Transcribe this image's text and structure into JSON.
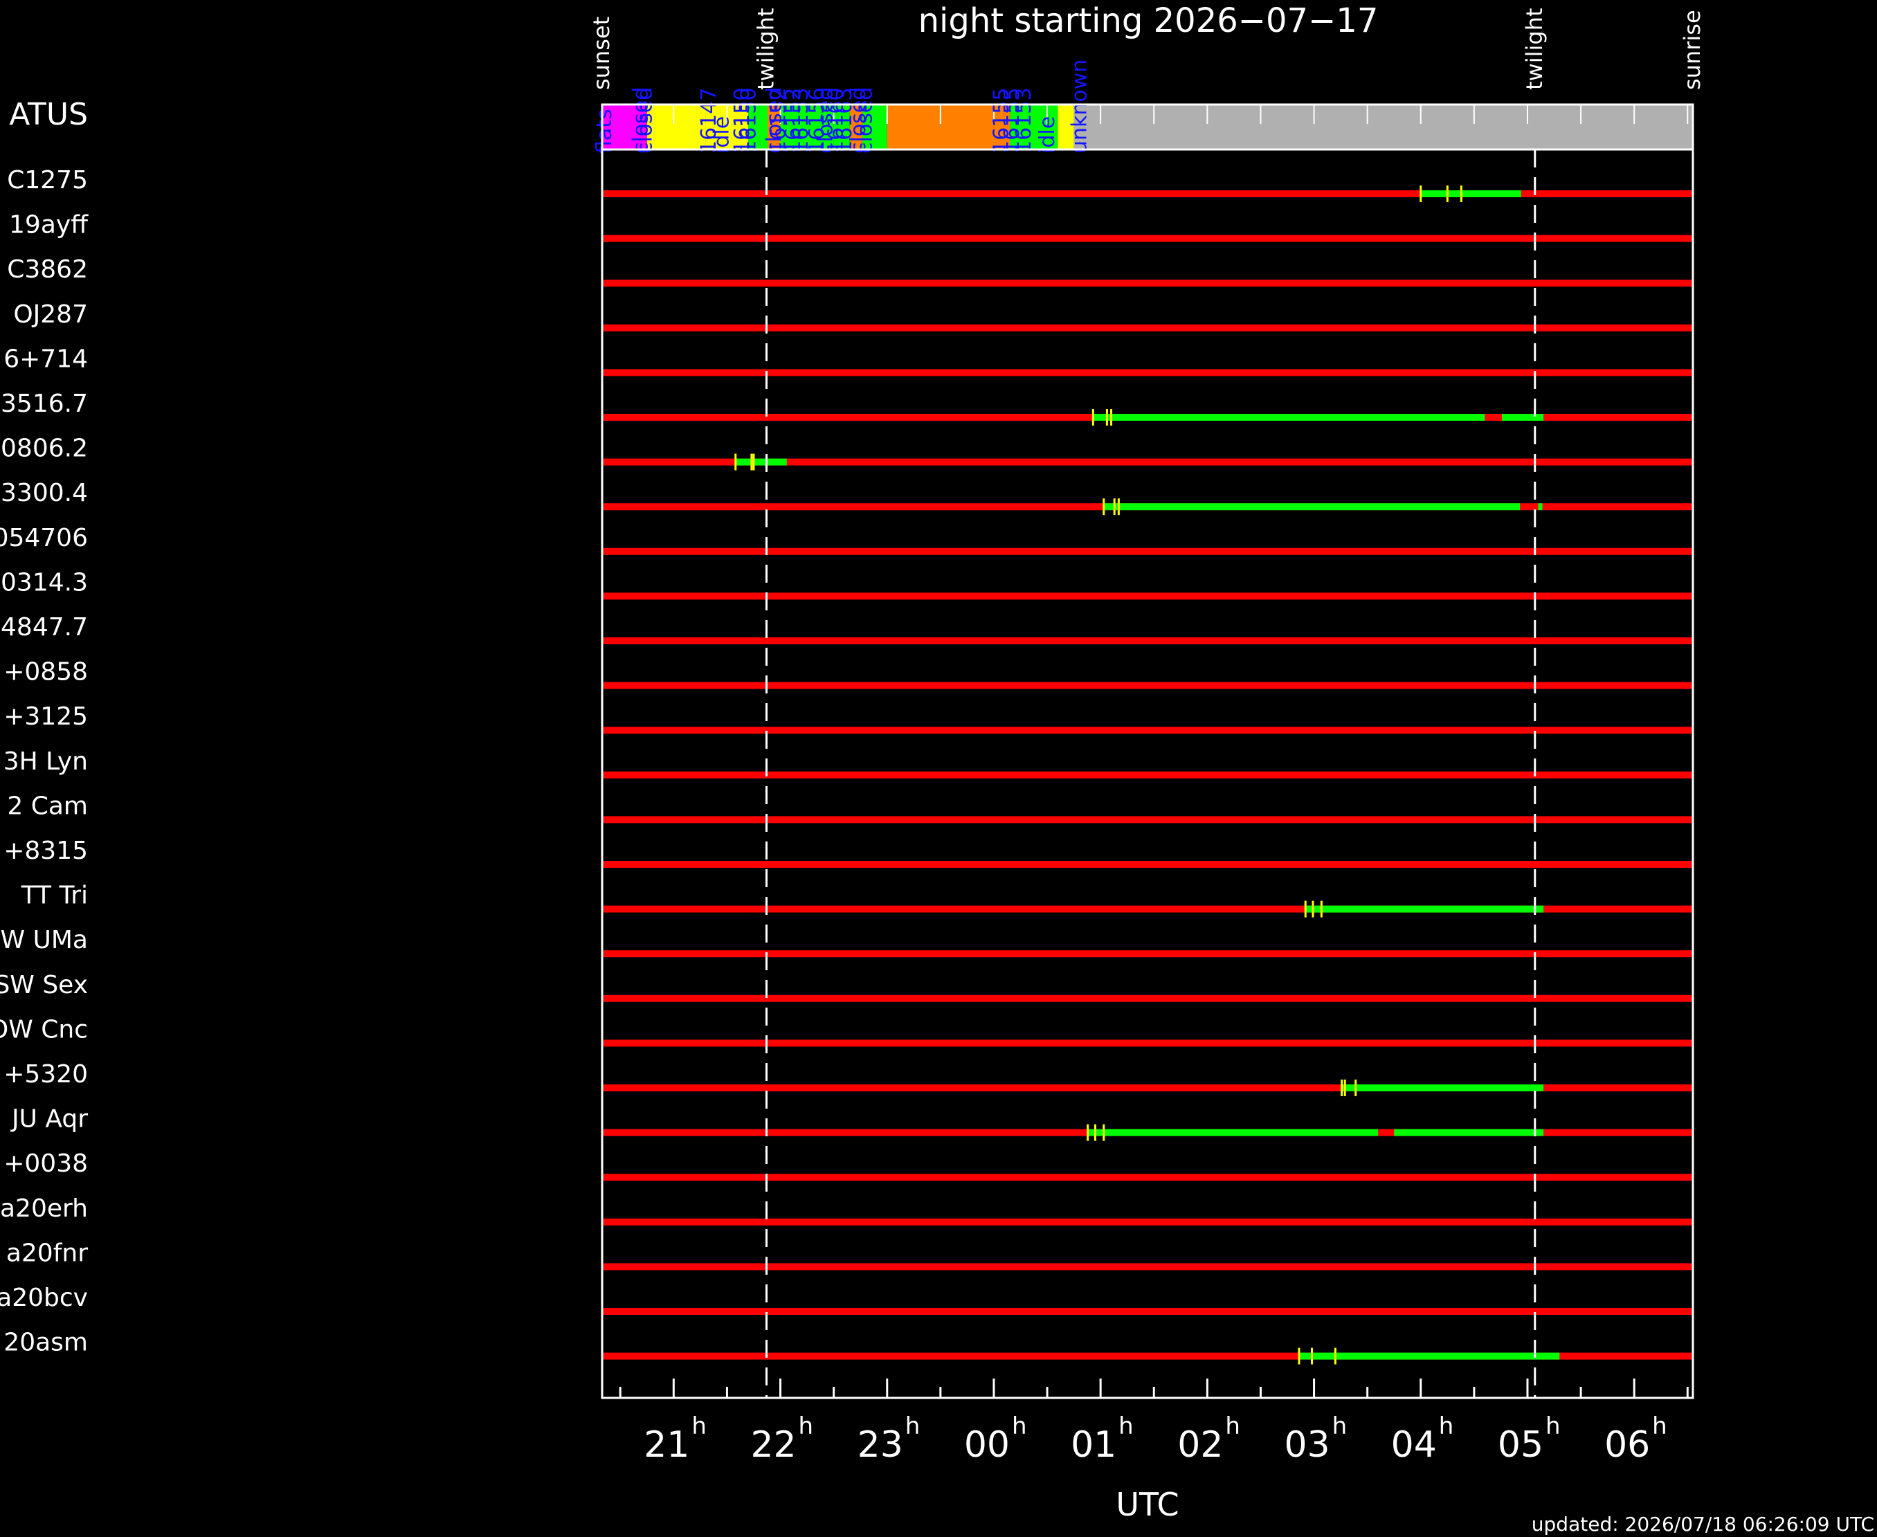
{
  "title": "night starting 2026−07−17",
  "status_label": "ATUS",
  "updated": "updated: 2026/07/18 06:26:09 UTC",
  "colors": {
    "red": "#ff0000",
    "green": "#00ff00",
    "yellow": "#ffff00",
    "magenta": "#ff00ff",
    "orange": "#ff8000",
    "gray": "#b0b0b0",
    "blue": "#1414ff"
  },
  "chart_data": {
    "type": "timeline",
    "xlabel": "UTC",
    "xlim": [
      20.33,
      30.55
    ],
    "x_ticks": [
      {
        "v": 21,
        "label": "21",
        "sup": "h"
      },
      {
        "v": 22,
        "label": "22",
        "sup": "h"
      },
      {
        "v": 23,
        "label": "23",
        "sup": "h"
      },
      {
        "v": 24,
        "label": "00",
        "sup": "h"
      },
      {
        "v": 25,
        "label": "01",
        "sup": "h"
      },
      {
        "v": 26,
        "label": "02",
        "sup": "h"
      },
      {
        "v": 27,
        "label": "03",
        "sup": "h"
      },
      {
        "v": 28,
        "label": "04",
        "sup": "h"
      },
      {
        "v": 29,
        "label": "05",
        "sup": "h"
      },
      {
        "v": 30,
        "label": "06",
        "sup": "h"
      }
    ],
    "markers": [
      {
        "t": 20.33,
        "label": "sunset",
        "dashed": false
      },
      {
        "t": 21.87,
        "label": "twilight",
        "dashed": true
      },
      {
        "t": 29.07,
        "label": "twilight",
        "dashed": true
      },
      {
        "t": 30.55,
        "label": "sunrise",
        "dashed": false
      }
    ],
    "status_bar": [
      {
        "start": 20.33,
        "end": 20.75,
        "state": "flats",
        "color": "#ff00ff"
      },
      {
        "start": 20.75,
        "end": 21.3,
        "state": "idle",
        "color": "#ffff00"
      },
      {
        "start": 21.3,
        "end": 21.7,
        "state": "idle",
        "color": "#ffff00"
      },
      {
        "start": 21.7,
        "end": 21.88,
        "state": "observing",
        "color": "#00ff00"
      },
      {
        "start": 21.88,
        "end": 22.0,
        "state": "closed",
        "color": "#ff8000"
      },
      {
        "start": 22.0,
        "end": 22.5,
        "state": "observing",
        "color": "#00ff00"
      },
      {
        "start": 22.5,
        "end": 22.65,
        "state": "observing",
        "color": "#00ff00"
      },
      {
        "start": 22.65,
        "end": 22.77,
        "state": "closed",
        "color": "#ff8000"
      },
      {
        "start": 22.77,
        "end": 23.0,
        "state": "observing",
        "color": "#00ff00"
      },
      {
        "start": 23.0,
        "end": 24.15,
        "state": "closed",
        "color": "#ff8000"
      },
      {
        "start": 24.15,
        "end": 24.6,
        "state": "observing",
        "color": "#00ff00"
      },
      {
        "start": 24.6,
        "end": 24.75,
        "state": "idle",
        "color": "#ffff00"
      },
      {
        "start": 24.75,
        "end": 30.55,
        "state": "unknown",
        "color": "#b0b0b0"
      }
    ],
    "status_labels": [
      {
        "t": 20.35,
        "text": "flats"
      },
      {
        "t": 20.69,
        "text": "closed"
      },
      {
        "t": 20.73,
        "text": "closed"
      },
      {
        "t": 21.33,
        "text": "16147"
      },
      {
        "t": 21.45,
        "text": "idle"
      },
      {
        "t": 21.64,
        "text": "16150"
      },
      {
        "t": 21.7,
        "text": "16150"
      },
      {
        "t": 21.94,
        "text": "closed"
      },
      {
        "t": 21.98,
        "text": "16152"
      },
      {
        "t": 22.12,
        "text": "16152"
      },
      {
        "t": 22.19,
        "text": "16153"
      },
      {
        "t": 22.34,
        "text": "16156"
      },
      {
        "t": 22.42,
        "text": "closed"
      },
      {
        "t": 22.52,
        "text": "16160"
      },
      {
        "t": 22.6,
        "text": "16163"
      },
      {
        "t": 22.73,
        "text": "closed"
      },
      {
        "t": 22.79,
        "text": "closed"
      },
      {
        "t": 24.07,
        "text": "16155"
      },
      {
        "t": 24.17,
        "text": "16155"
      },
      {
        "t": 24.28,
        "text": "16153"
      },
      {
        "t": 24.5,
        "text": "idle"
      },
      {
        "t": 24.8,
        "text": "unknown"
      }
    ],
    "rows": [
      {
        "label": "C1275",
        "obs": [
          [
            28.0,
            28.94
          ]
        ],
        "ticks": [
          28.0,
          28.25,
          28.38
        ]
      },
      {
        "label": "19ayff",
        "obs": [],
        "ticks": []
      },
      {
        "label": "C3862",
        "obs": [],
        "ticks": []
      },
      {
        "label": "OJ287",
        "obs": [],
        "ticks": []
      },
      {
        "label": "6+714",
        "obs": [],
        "ticks": []
      },
      {
        "label": "3516.7",
        "obs": [
          [
            24.93,
            28.6
          ],
          [
            28.76,
            29.15
          ]
        ],
        "ticks": [
          24.93,
          25.06,
          25.1
        ]
      },
      {
        "label": "0806.2",
        "obs": [
          [
            21.58,
            22.06
          ]
        ],
        "ticks": [
          21.58,
          21.73,
          21.75
        ]
      },
      {
        "label": "3300.4",
        "obs": [
          [
            25.03,
            28.93
          ],
          [
            29.1,
            29.14
          ]
        ],
        "ticks": [
          25.03,
          25.13,
          25.17
        ]
      },
      {
        "label": "054706",
        "obs": [],
        "ticks": []
      },
      {
        "label": "0314.3",
        "obs": [],
        "ticks": []
      },
      {
        "label": "4847.7",
        "obs": [],
        "ticks": []
      },
      {
        "label": "+0858",
        "obs": [],
        "ticks": []
      },
      {
        "label": "+3125",
        "obs": [],
        "ticks": []
      },
      {
        "label": "3H Lyn",
        "obs": [],
        "ticks": []
      },
      {
        "label": "2 Cam",
        "obs": [],
        "ticks": []
      },
      {
        "label": "+8315",
        "obs": [],
        "ticks": []
      },
      {
        "label": "TT Tri",
        "obs": [
          [
            26.92,
            29.15
          ]
        ],
        "ticks": [
          26.92,
          26.99,
          27.07
        ]
      },
      {
        "label": "W UMa",
        "obs": [],
        "ticks": []
      },
      {
        "label": "SW Sex",
        "obs": [],
        "ticks": []
      },
      {
        "label": "OW Cnc",
        "obs": [],
        "ticks": []
      },
      {
        "label": "+5320",
        "obs": [
          [
            27.26,
            29.15
          ]
        ],
        "ticks": [
          27.26,
          27.29,
          27.39
        ]
      },
      {
        "label": "JU Aqr",
        "obs": [
          [
            24.88,
            27.6
          ],
          [
            27.75,
            29.15
          ]
        ],
        "ticks": [
          24.88,
          24.95,
          25.03
        ]
      },
      {
        "label": "+0038",
        "obs": [],
        "ticks": []
      },
      {
        "label": "a20erh",
        "obs": [],
        "ticks": []
      },
      {
        "label": "a20fnr",
        "obs": [],
        "ticks": []
      },
      {
        "label": "a20bcv",
        "obs": [],
        "ticks": []
      },
      {
        "label": "20asm",
        "obs": [
          [
            26.86,
            29.3
          ]
        ],
        "ticks": [
          26.86,
          26.98,
          27.2
        ]
      }
    ]
  }
}
